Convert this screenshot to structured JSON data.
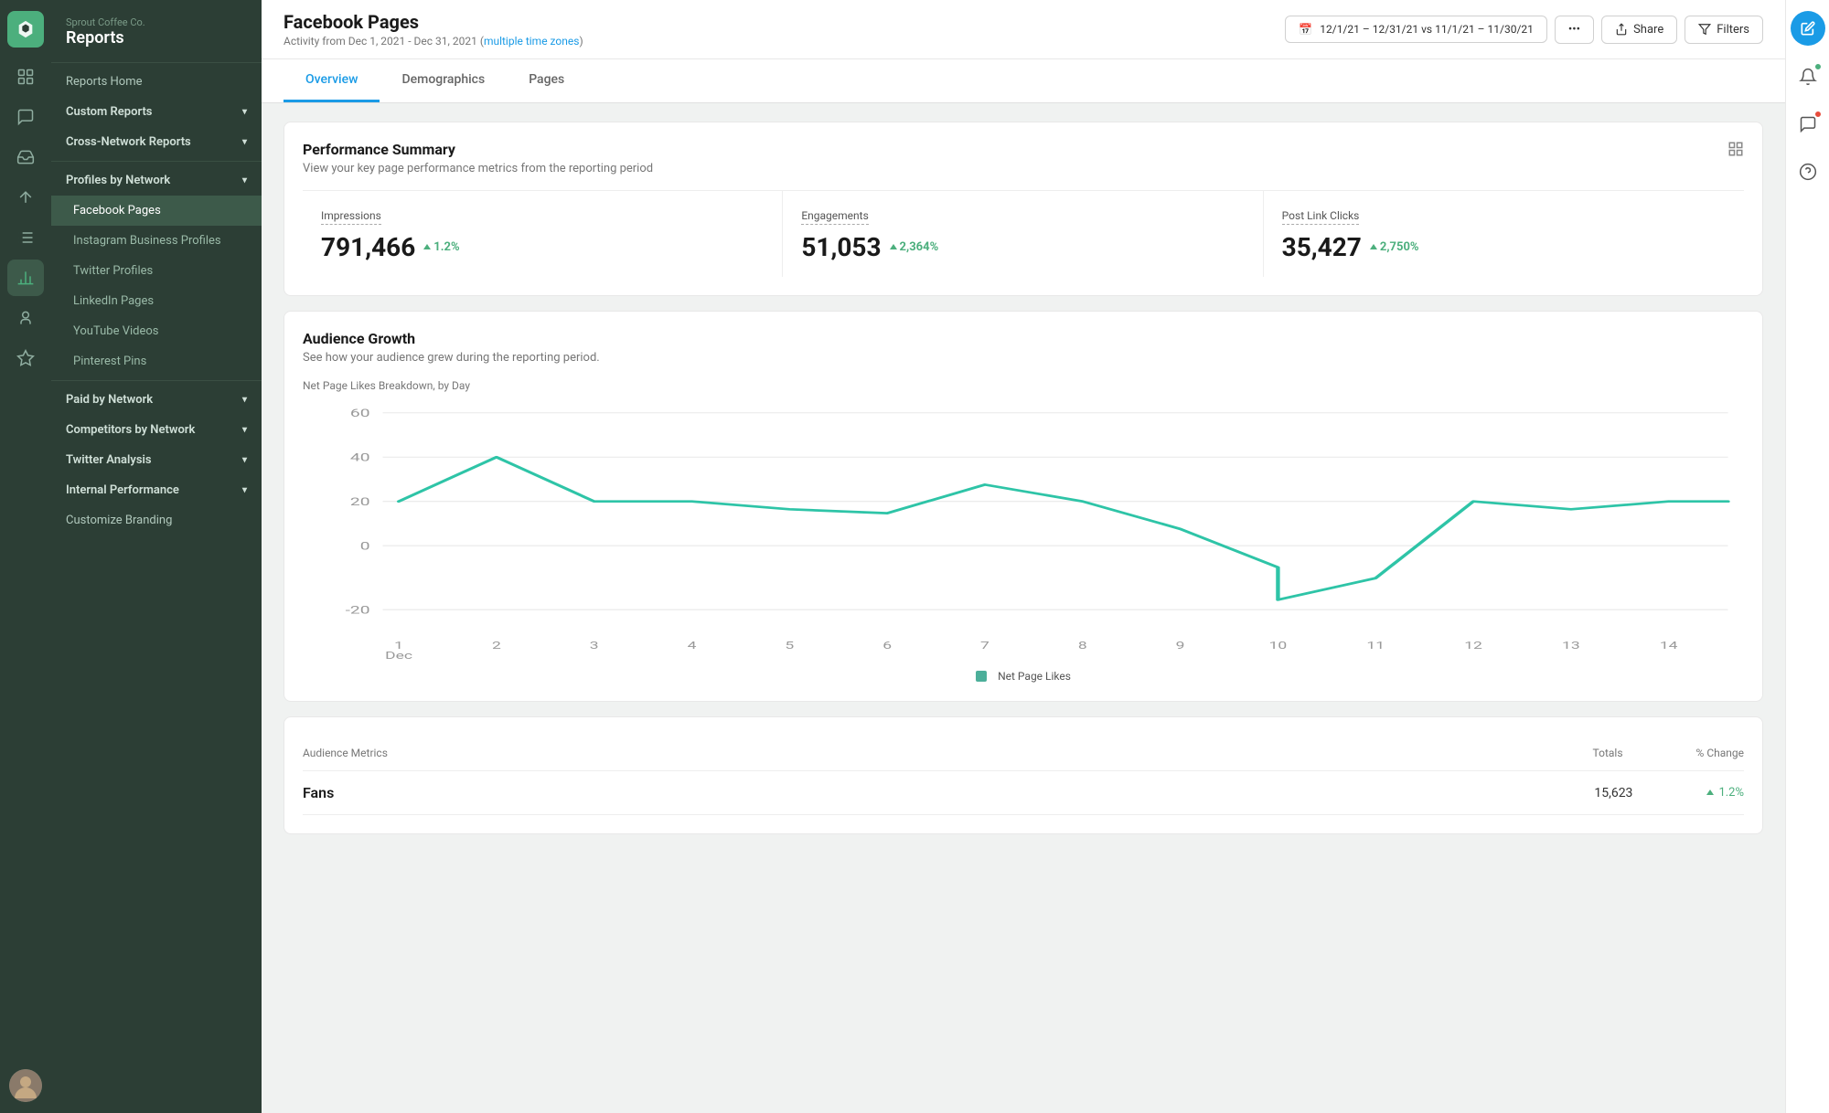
{
  "brand": {
    "company": "Sprout Coffee Co.",
    "section": "Reports"
  },
  "sidebar": {
    "items": [
      {
        "id": "reports-home",
        "label": "Reports Home",
        "level": 0,
        "hasChevron": false,
        "active": false
      },
      {
        "id": "custom-reports",
        "label": "Custom Reports",
        "level": 0,
        "hasChevron": true,
        "active": false
      },
      {
        "id": "cross-network-reports",
        "label": "Cross-Network Reports",
        "level": 0,
        "hasChevron": true,
        "active": false
      },
      {
        "id": "profiles-by-network",
        "label": "Profiles by Network",
        "level": 0,
        "hasChevron": true,
        "active": false,
        "expanded": true
      },
      {
        "id": "facebook-pages",
        "label": "Facebook Pages",
        "level": 1,
        "hasChevron": false,
        "active": true
      },
      {
        "id": "instagram-business-profiles",
        "label": "Instagram Business Profiles",
        "level": 1,
        "hasChevron": false,
        "active": false
      },
      {
        "id": "twitter-profiles",
        "label": "Twitter Profiles",
        "level": 1,
        "hasChevron": false,
        "active": false
      },
      {
        "id": "linkedin-pages",
        "label": "LinkedIn Pages",
        "level": 1,
        "hasChevron": false,
        "active": false
      },
      {
        "id": "youtube-videos",
        "label": "YouTube Videos",
        "level": 1,
        "hasChevron": false,
        "active": false
      },
      {
        "id": "pinterest-pins",
        "label": "Pinterest Pins",
        "level": 1,
        "hasChevron": false,
        "active": false
      },
      {
        "id": "paid-by-network",
        "label": "Paid by Network",
        "level": 0,
        "hasChevron": true,
        "active": false
      },
      {
        "id": "competitors-by-network",
        "label": "Competitors by Network",
        "level": 0,
        "hasChevron": true,
        "active": false
      },
      {
        "id": "twitter-analysis",
        "label": "Twitter Analysis",
        "level": 0,
        "hasChevron": true,
        "active": false
      },
      {
        "id": "internal-performance",
        "label": "Internal Performance",
        "level": 0,
        "hasChevron": true,
        "active": false
      },
      {
        "id": "customize-branding",
        "label": "Customize Branding",
        "level": 0,
        "hasChevron": false,
        "active": false
      }
    ]
  },
  "header": {
    "title": "Facebook Pages",
    "subtitle": "Activity from Dec 1, 2021 - Dec 31, 2021",
    "timezone_link": "multiple time zones",
    "date_range": "12/1/21 – 12/31/21 vs 11/1/21 – 11/30/21",
    "share_label": "Share",
    "filters_label": "Filters"
  },
  "tabs": [
    {
      "id": "overview",
      "label": "Overview",
      "active": true
    },
    {
      "id": "demographics",
      "label": "Demographics",
      "active": false
    },
    {
      "id": "pages",
      "label": "Pages",
      "active": false
    }
  ],
  "performance_summary": {
    "title": "Performance Summary",
    "subtitle": "View your key page performance metrics from the reporting period",
    "metrics": [
      {
        "id": "impressions",
        "label": "Impressions",
        "value": "791,466",
        "change": "1.2%",
        "positive": true
      },
      {
        "id": "engagements",
        "label": "Engagements",
        "value": "51,053",
        "change": "2,364%",
        "positive": true
      },
      {
        "id": "post-link-clicks",
        "label": "Post Link Clicks",
        "value": "35,427",
        "change": "2,750%",
        "positive": true
      }
    ]
  },
  "audience_growth": {
    "title": "Audience Growth",
    "subtitle": "See how your audience grew during the reporting period.",
    "chart_label": "Net Page Likes Breakdown, by Day",
    "y_axis": [
      "60",
      "40",
      "20",
      "0",
      "-20"
    ],
    "x_axis": [
      "1\nDec",
      "2",
      "3",
      "4",
      "5",
      "6",
      "7",
      "8",
      "9",
      "10",
      "11",
      "12",
      "13",
      "14"
    ],
    "legend": "Net Page Likes"
  },
  "audience_metrics": {
    "title": "Audience Metrics",
    "columns": {
      "metric": "Audience Metrics",
      "totals": "Totals",
      "change": "% Change"
    },
    "rows": [
      {
        "label": "Fans",
        "total": "15,623",
        "change": "1.2%",
        "positive": true
      }
    ]
  },
  "colors": {
    "accent_blue": "#1a9be6",
    "accent_green": "#4caf7d",
    "chart_line": "#2ec4a7",
    "sidebar_bg": "#2c3e35",
    "sidebar_active": "#4a6658"
  }
}
